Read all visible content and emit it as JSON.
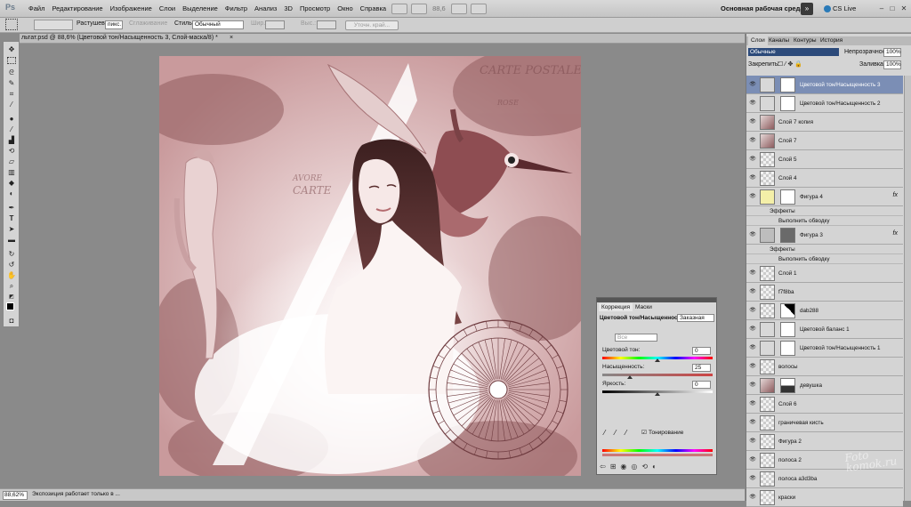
{
  "menu": [
    "Файл",
    "Редактирование",
    "Изображение",
    "Слои",
    "Выделение",
    "Фильтр",
    "Анализ",
    "3D",
    "Просмотр",
    "Окно",
    "Справка"
  ],
  "workspace": "Основная рабочая среда",
  "cslive": "CS Live",
  "options": {
    "feather_label": "Растушевка:",
    "feather_value": "пикс.",
    "antialias": "Сглаживание",
    "style_label": "Стиль:",
    "style_value": "Обычный",
    "width_label": "Шир.:",
    "height_label": "Выс.:",
    "refine": "Уточн. край..."
  },
  "zoom_menu": "88,6",
  "doc_tab": "льтат.psd @ 88,6% (Цветовой тон/Насыщенность 3, Слой-маска/8) *",
  "status": {
    "zoom": "88,62%",
    "text": "Экспозиция работает только в ..."
  },
  "adjustments": {
    "tabs": [
      "Коррекция",
      "Маски"
    ],
    "title": "Цветовой тон/Насыщенность",
    "preset": "Заказная",
    "channel": "Все",
    "hue_label": "Цветовой тон:",
    "hue": "0",
    "hue_fraction": 0.5,
    "sat_label": "Насыщенность:",
    "sat": "25",
    "sat_fraction": 0.25,
    "light_label": "Яркость:",
    "light": "0",
    "light_fraction": 0.5,
    "colorize_label": "Тонирование",
    "colorize": true
  },
  "layers_panel": {
    "tabs": [
      "Слои",
      "Каналы",
      "Контуры",
      "История"
    ],
    "blend": "Обычные",
    "opacity_label": "Непрозрачность:",
    "opacity": "100%",
    "lock_label": "Закрепить:",
    "fill_label": "Заливка:",
    "fill": "100%",
    "layers": [
      {
        "name": "Цветовой тон/Насыщенность 3",
        "selected": true
      },
      {
        "name": "Цветовой тон/Насыщенность 2"
      },
      {
        "name": "Слой 7 копия"
      },
      {
        "name": "Слой 7"
      },
      {
        "name": "Слой 5"
      },
      {
        "name": "Слой 4"
      },
      {
        "name": "Фигура 4",
        "fx": "fx"
      },
      {
        "name": "Фигура 3",
        "fx": "fx"
      },
      {
        "name": "Слой 1"
      },
      {
        "name": "f7f8ba"
      },
      {
        "name": "dab288"
      },
      {
        "name": "Цветовой баланс 1"
      },
      {
        "name": "Цветовой тон/Насыщенность 1"
      },
      {
        "name": "волосы"
      },
      {
        "name": "девушка"
      },
      {
        "name": "Слой 6"
      },
      {
        "name": "граничевая кисть"
      },
      {
        "name": "Фигура 2"
      },
      {
        "name": "полоса 2"
      },
      {
        "name": "полоса a3d3ba"
      },
      {
        "name": "краски"
      }
    ],
    "effects": "Эффекты",
    "stroke": "Выполнить обводку"
  },
  "canvas_text": {
    "postcard": "CARTE POSTALE",
    "rose": "ROSE",
    "ravore": "AVORE",
    "carte": "CARTE"
  },
  "watermark": "Foto komok.ru"
}
